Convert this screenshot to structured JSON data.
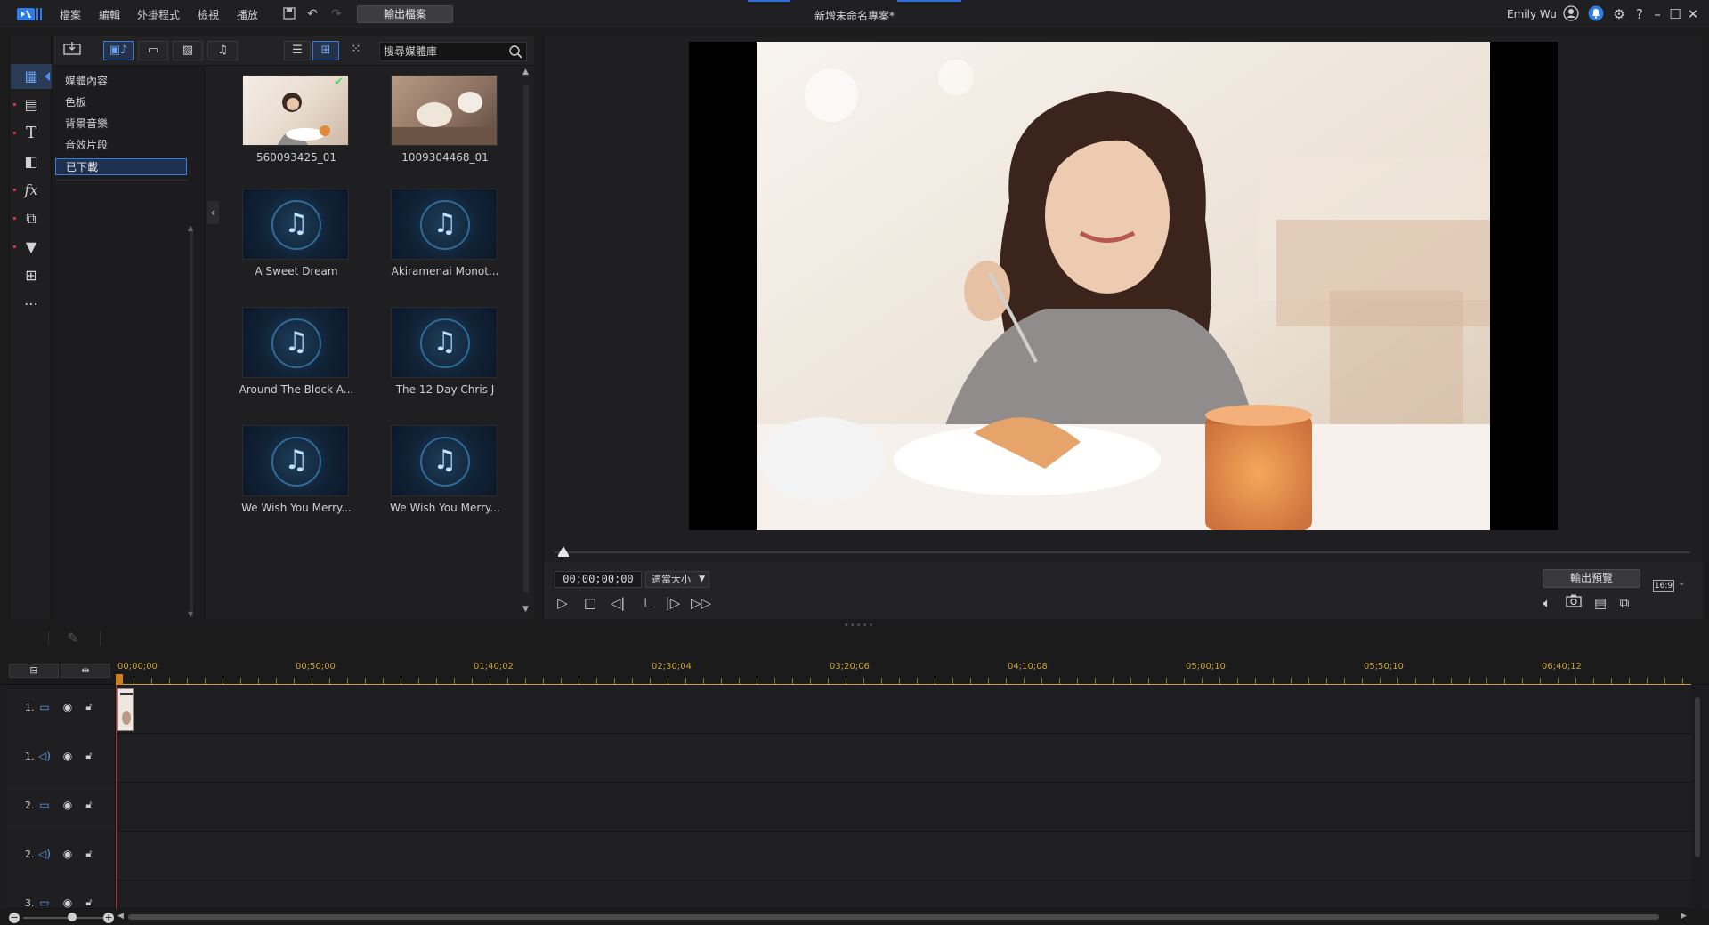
{
  "menu": {
    "items": [
      "檔案",
      "編輯",
      "外掛程式",
      "檢視",
      "播放"
    ],
    "produce_label": "輸出檔案"
  },
  "project_title": "新增未命名專案*",
  "user": {
    "name": "Emily Wu"
  },
  "library": {
    "search_placeholder": "搜尋媒體庫",
    "categories": [
      "媒體內容",
      "色板",
      "背景音樂",
      "音效片段",
      "已下載"
    ],
    "selected_category": "已下載",
    "items": [
      {
        "label": "560093425_01",
        "kind": "image",
        "downloaded": true
      },
      {
        "label": "1009304468_01",
        "kind": "image",
        "downloaded": false
      },
      {
        "label": "A Sweet Dream",
        "kind": "music"
      },
      {
        "label": "Akiramenai Monot...",
        "kind": "music"
      },
      {
        "label": "Around The Block A...",
        "kind": "music"
      },
      {
        "label": "The 12 Day Chris J",
        "kind": "music"
      },
      {
        "label": "We Wish You Merry...",
        "kind": "music"
      },
      {
        "label": "We Wish You Merry...",
        "kind": "music"
      }
    ]
  },
  "preview": {
    "timecode": "00;00;00;00",
    "fit_label": "適當大小",
    "produce_preview_label": "輸出預覽",
    "aspect_ratio": "16:9"
  },
  "timeline": {
    "ruler_labels": [
      "00;00;00",
      "00;50;00",
      "01;40;02",
      "02;30;04",
      "03;20;06",
      "04;10;08",
      "05;00;10",
      "05;50;10",
      "06;40;12"
    ],
    "tracks": [
      {
        "num": "1.",
        "type": "video"
      },
      {
        "num": "1.",
        "type": "audio"
      },
      {
        "num": "2.",
        "type": "video"
      },
      {
        "num": "2.",
        "type": "audio"
      },
      {
        "num": "3.",
        "type": "video"
      }
    ]
  },
  "colors": {
    "accent": "#3f79d6",
    "playhead": "#c8202a",
    "ruler": "#c8a33b"
  }
}
